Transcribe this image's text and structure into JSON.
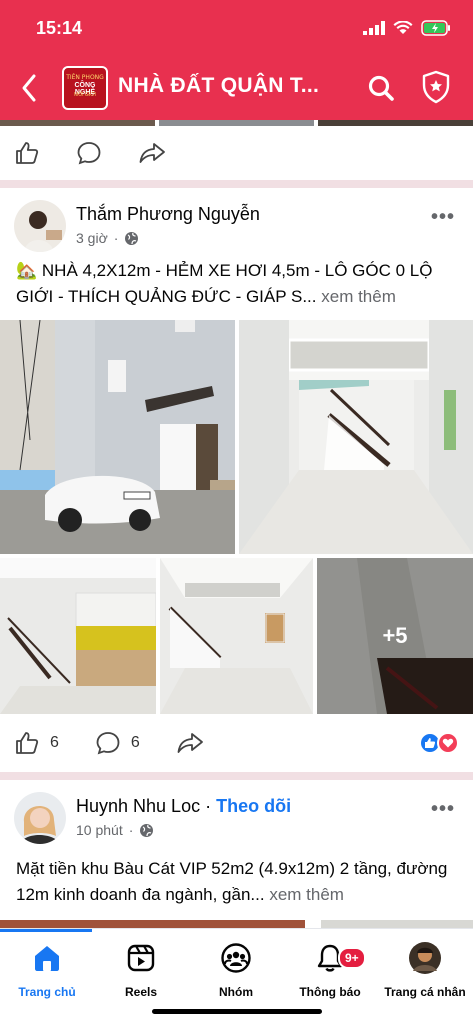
{
  "status_bar": {
    "time": "15:14"
  },
  "header": {
    "title": "NHÀ ĐẤT QUẬN T...",
    "logo_lines": [
      "TIÊN PHONG",
      "CÔNG NGHỆ",
      "MÔI GIỚI"
    ],
    "accent": "#e8304f"
  },
  "posts": [
    {
      "author": "Thắm Phương Nguyễn",
      "time": "3 giờ",
      "text": "🏡 NHÀ 4,2X12m - HẺM XE HƠI 4,5m - LÔ GÓC 0 LỘ GIỚI - THÍCH QUẢNG ĐỨC - GIÁP S...",
      "see_more": "xem thêm",
      "more_photos": "+5",
      "likes": "6",
      "comments": "6"
    },
    {
      "author": "Huynh Nhu Loc",
      "follow": "Theo dõi",
      "time": "10 phút",
      "text": "Mặt tiền khu Bàu Cát VIP 52m2 (4.9x12m) 2 tầng, đường 12m kinh doanh đa ngành, gần...",
      "see_more": "xem thêm"
    }
  ],
  "tabs": [
    {
      "label": "Trang chủ",
      "icon": "home-icon",
      "active": true
    },
    {
      "label": "Reels",
      "icon": "reels-icon"
    },
    {
      "label": "Nhóm",
      "icon": "groups-icon"
    },
    {
      "label": "Thông báo",
      "icon": "bell-icon",
      "badge": "9+"
    },
    {
      "label": "Trang cá nhân",
      "icon": "profile-icon"
    }
  ]
}
